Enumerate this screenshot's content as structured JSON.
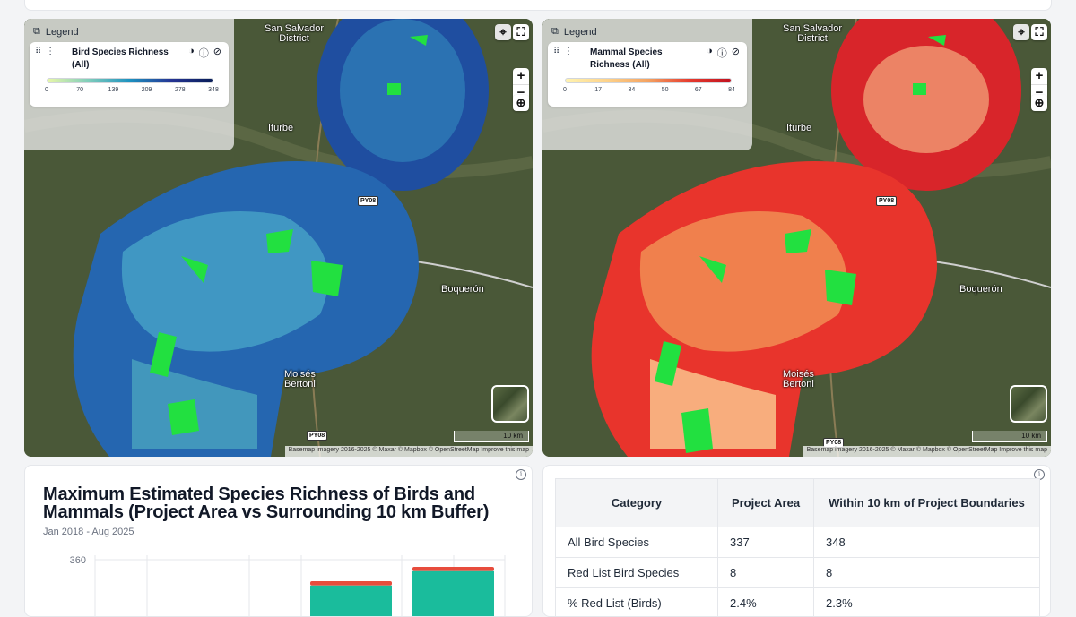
{
  "legend": {
    "title": "Legend",
    "left_item": {
      "label": "Bird Species Richness (All)",
      "ticks": [
        "0",
        "70",
        "139",
        "209",
        "278",
        "348"
      ],
      "colors": [
        "#e8f7a8",
        "#7fcdbb",
        "#1d91c0",
        "#253494",
        "#081d58"
      ]
    },
    "right_item": {
      "label": "Mammal Species Richness (All)",
      "ticks": [
        "0",
        "17",
        "34",
        "50",
        "67",
        "84"
      ],
      "colors": [
        "#fff3b0",
        "#fdd28a",
        "#f4a261",
        "#e63b2e",
        "#c1121f"
      ]
    }
  },
  "map": {
    "places": {
      "san_salvador": "San Salvador\nDistrict",
      "iturbe": "Iturbe",
      "boqueron": "Boquerón",
      "moises_bertoni": "Moisés\nBertoni"
    },
    "road_labels": [
      "PY08",
      "PY08"
    ],
    "scale_label": "10 km",
    "attribution": "Basemap imagery 2016-2025 © Maxar © Mapbox © OpenStreetMap Improve this map",
    "zoom_in": "+",
    "zoom_out": "−"
  },
  "chart": {
    "title": "Maximum Estimated Species Richness of Birds and Mammals (Project Area vs Surrounding 10 km Buffer)",
    "subtitle": "Jan 2018 - Aug 2025",
    "colors": {
      "base": "#1abc9c",
      "red_list": "#e74c3c"
    }
  },
  "chart_data": {
    "type": "bar",
    "stacked": true,
    "yticks": [
      "360"
    ],
    "bars": [
      {
        "total": 348,
        "red_list": 8
      },
      {
        "total": 356,
        "red_list": 8
      }
    ]
  },
  "table": {
    "headers": [
      "Category",
      "Project Area",
      "Within 10 km of Project Boundaries"
    ],
    "rows": [
      [
        "All Bird Species",
        "337",
        "348"
      ],
      [
        "Red List Bird Species",
        "8",
        "8"
      ],
      [
        "% Red List (Birds)",
        "2.4%",
        "2.3%"
      ]
    ]
  },
  "info_icon": "i"
}
